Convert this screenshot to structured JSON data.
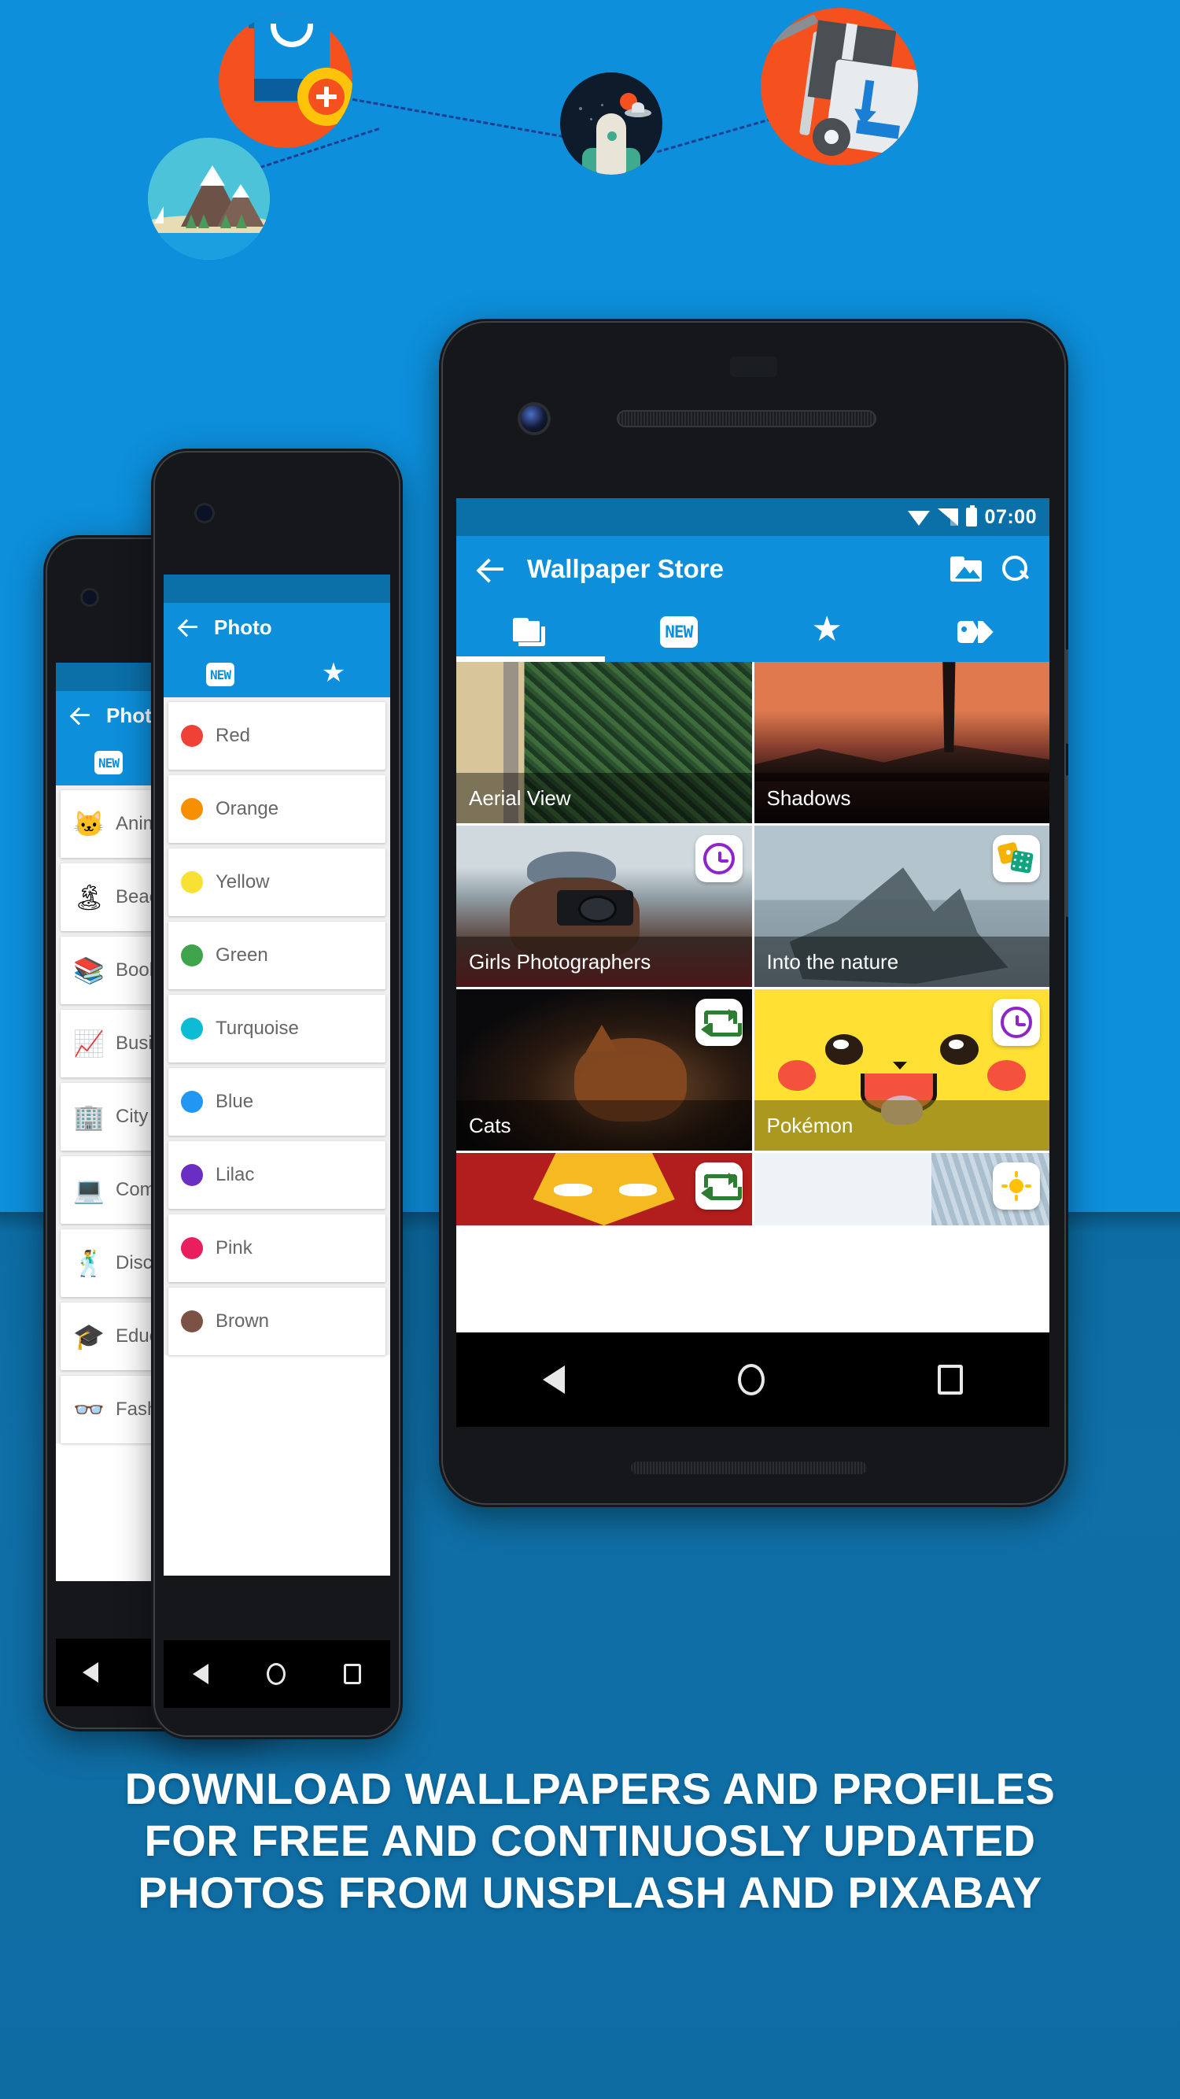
{
  "background": {
    "top_color": "#0d8fdb",
    "bottom_color": "#0f6ca5"
  },
  "hero": {
    "icons": [
      {
        "name": "mountain-landscape-circle",
        "label": "Mountain Landscape"
      },
      {
        "name": "shopping-bag-plus-circle",
        "label": "Store Bag Add"
      },
      {
        "name": "rocket-space-circle",
        "label": "Rocket Launch"
      },
      {
        "name": "delivery-cart-download-circle",
        "label": "Download Delivery"
      }
    ]
  },
  "front_phone": {
    "status_bar": {
      "time": "07:00",
      "icons": [
        "wifi-icon",
        "signal-icon",
        "battery-icon"
      ]
    },
    "app_bar": {
      "back_label": "←",
      "title": "Wallpaper Store",
      "actions": [
        "photo-folder-icon",
        "search-icon"
      ]
    },
    "tabs": [
      {
        "name": "tab-folders",
        "icon": "folders-icon",
        "label": "",
        "active": true
      },
      {
        "name": "tab-new",
        "icon": "new-badge-icon",
        "label": "NEW",
        "active": false
      },
      {
        "name": "tab-favorites",
        "icon": "star-icon",
        "label": "",
        "active": false
      },
      {
        "name": "tab-tags",
        "icon": "tags-icon",
        "label": "",
        "active": false
      }
    ],
    "grid": [
      {
        "title": "Aerial View",
        "badge": ""
      },
      {
        "title": "Shadows",
        "badge": ""
      },
      {
        "title": "Girls Photographers",
        "badge": "clock-icon"
      },
      {
        "title": "Into the nature",
        "badge": "cards-icon"
      },
      {
        "title": "Cats",
        "badge": "repeat-icon"
      },
      {
        "title": "Pokémon",
        "badge": "clock-icon"
      },
      {
        "title": "",
        "badge": "repeat-icon"
      },
      {
        "title": "",
        "badge": "sun-icon"
      }
    ],
    "nav_bar": [
      "back-nav-icon",
      "home-nav-icon",
      "recents-nav-icon"
    ]
  },
  "mid_phone": {
    "app_bar": {
      "title": "Photo"
    },
    "tabs": [
      {
        "label": "NEW"
      },
      {
        "label": ""
      }
    ],
    "colors": [
      {
        "label": "Red",
        "color": "#ef4136"
      },
      {
        "label": "Orange",
        "color": "#f79000"
      },
      {
        "label": "Yellow",
        "color": "#f8e133"
      },
      {
        "label": "Green",
        "color": "#3ea34b"
      },
      {
        "label": "Turquoise",
        "color": "#0cbcd4"
      },
      {
        "label": "Blue",
        "color": "#2196f3"
      },
      {
        "label": "Lilac",
        "color": "#6a2ec2"
      },
      {
        "label": "Pink",
        "color": "#e91e5e"
      },
      {
        "label": "Brown",
        "color": "#7c5245"
      }
    ]
  },
  "back_phone": {
    "app_bar": {
      "title": "Photo"
    },
    "tabs": [
      {
        "label": "NEW"
      },
      {
        "label": ""
      }
    ],
    "categories": [
      {
        "label": "Animals",
        "emoji": "🐱"
      },
      {
        "label": "Beach",
        "emoji": "🏝"
      },
      {
        "label": "Books",
        "emoji": "📚"
      },
      {
        "label": "Business",
        "emoji": "📈"
      },
      {
        "label": "City",
        "emoji": "🏢"
      },
      {
        "label": "Computer",
        "emoji": "💻"
      },
      {
        "label": "Disco",
        "emoji": "🕺"
      },
      {
        "label": "Education",
        "emoji": "🎓"
      },
      {
        "label": "Fashion",
        "emoji": "👓"
      }
    ]
  },
  "caption": {
    "line1": "DOWNLOAD WALLPAPERS AND PROFILES",
    "line2": "FOR FREE AND CONTINUOSLY UPDATED",
    "line3": "PHOTOS FROM UNSPLASH AND PIXABAY"
  }
}
